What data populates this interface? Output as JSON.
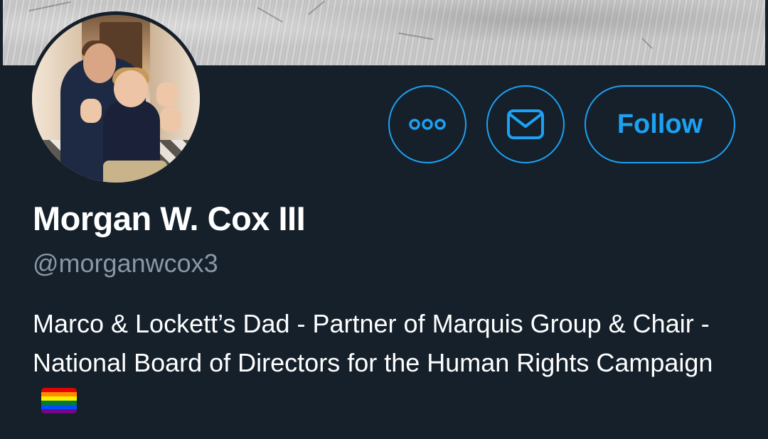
{
  "profile": {
    "name": "Morgan W. Cox III",
    "handle": "@morganwcox3",
    "bio": "Marco & Lockett’s Dad - Partner of Marquis Group & Chair - National Board of Directors for the Human Rights Campaign",
    "bio_emoji": "rainbow-flag-icon"
  },
  "actions": {
    "more_icon": "more-icon",
    "message_icon": "envelope-icon",
    "follow_label": "Follow"
  },
  "colors": {
    "background": "#15202b",
    "accent": "#1da1f2",
    "secondary_text": "#8899a6"
  }
}
